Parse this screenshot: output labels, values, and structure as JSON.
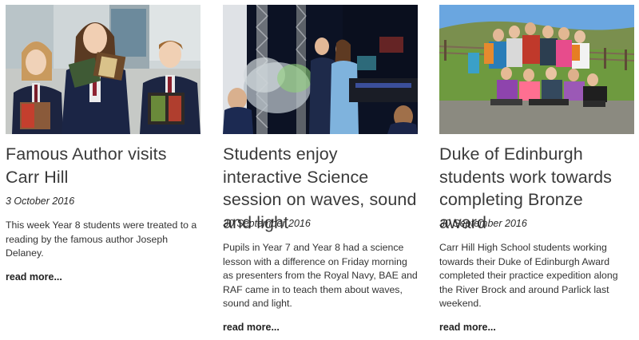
{
  "articles": [
    {
      "image_alt": "Three students holding copies of books",
      "title": "Famous Author visits Carr Hill",
      "date": "3 October 2016",
      "summary": "This week Year 8 students were treated to a reading by the famous author Joseph Delaney.",
      "read_more": "read more..."
    },
    {
      "image_alt": "Science presenters demonstrating on a stage with smoke",
      "title": "Students enjoy interactive Science session on waves, sound and light",
      "date": "30 September 2016",
      "summary": "Pupils in Year 7 and Year 8 had a science lesson with a difference on Friday morning as presenters from the Royal Navy, BAE and RAF came in to teach them about waves, sound and light.",
      "read_more": "read more..."
    },
    {
      "image_alt": "Group of students with rucksacks on a hillside",
      "title": "Duke of Edinburgh students work towards completing Bronze award",
      "date": "30 September 2016",
      "summary": "Carr Hill High School students working towards their Duke of Edinburgh Award completed their practice expedition along the River Brock and around Parlick last weekend.",
      "read_more": "read more..."
    }
  ]
}
